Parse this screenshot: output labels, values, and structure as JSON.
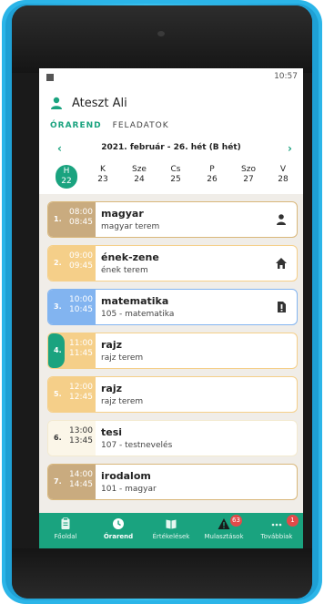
{
  "status_bar": {
    "time": "10:57"
  },
  "user": {
    "name": "Ateszt Ali"
  },
  "tabs": [
    {
      "label": "ÓRAREND",
      "active": true
    },
    {
      "label": "FELADATOK",
      "active": false
    }
  ],
  "week": {
    "label": "2021. február - 26. hét (B hét)",
    "prev_arrow": "‹",
    "next_arrow": "›"
  },
  "days": [
    {
      "abbr": "H",
      "date": "22",
      "active": true
    },
    {
      "abbr": "K",
      "date": "23",
      "active": false
    },
    {
      "abbr": "Sze",
      "date": "24",
      "active": false
    },
    {
      "abbr": "Cs",
      "date": "25",
      "active": false
    },
    {
      "abbr": "P",
      "date": "26",
      "active": false
    },
    {
      "abbr": "Szo",
      "date": "27",
      "active": false
    },
    {
      "abbr": "V",
      "date": "28",
      "active": false
    }
  ],
  "lessons": [
    {
      "num": "1.",
      "start": "08:00",
      "end": "08:45",
      "subject": "magyar",
      "room": "magyar terem",
      "icon": "person-icon",
      "side_color": "#c9ab7f",
      "border_color": "#d9b77a"
    },
    {
      "num": "2.",
      "start": "09:00",
      "end": "09:45",
      "subject": "ének-zene",
      "room": "ének terem",
      "icon": "home-icon",
      "side_color": "#f5cf89",
      "border_color": "#f5cf89"
    },
    {
      "num": "3.",
      "start": "10:00",
      "end": "10:45",
      "subject": "matematika",
      "room": "105 - matematika",
      "icon": "alert-icon",
      "side_color": "#82b4f0",
      "border_color": "#82b4f0"
    },
    {
      "num": "4.",
      "start": "11:00",
      "end": "11:45",
      "subject": "rajz",
      "room": "rajz terem",
      "icon": "",
      "side_color": "#f5cf89",
      "border_color": "#f5cf89",
      "highlight": "#1aa37f"
    },
    {
      "num": "5.",
      "start": "12:00",
      "end": "12:45",
      "subject": "rajz",
      "room": "rajz terem",
      "icon": "",
      "side_color": "#f5cf89",
      "border_color": "#f5cf89"
    },
    {
      "num": "6.",
      "start": "13:00",
      "end": "13:45",
      "subject": "tesi",
      "room": "107 - testnevelés",
      "icon": "",
      "side_color": "#fbf6e8",
      "border_color": "#f3ead0",
      "dark_text": true
    },
    {
      "num": "7.",
      "start": "14:00",
      "end": "14:45",
      "subject": "irodalom",
      "room": "101 - magyar",
      "icon": "",
      "side_color": "#c9ab7f",
      "border_color": "#d9b77a"
    }
  ],
  "nav": [
    {
      "label": "Főoldal",
      "icon": "clipboard-icon",
      "active": false
    },
    {
      "label": "Órarend",
      "icon": "clock-icon",
      "active": true
    },
    {
      "label": "Értékelések",
      "icon": "book-icon",
      "active": false
    },
    {
      "label": "Mulasztások",
      "icon": "warning-icon",
      "active": false,
      "badge": "63"
    },
    {
      "label": "Továbbiak",
      "icon": "more-icon",
      "active": false,
      "badge": "1"
    }
  ],
  "colors": {
    "accent": "#1aa37f",
    "case": "#2bb5e8"
  }
}
